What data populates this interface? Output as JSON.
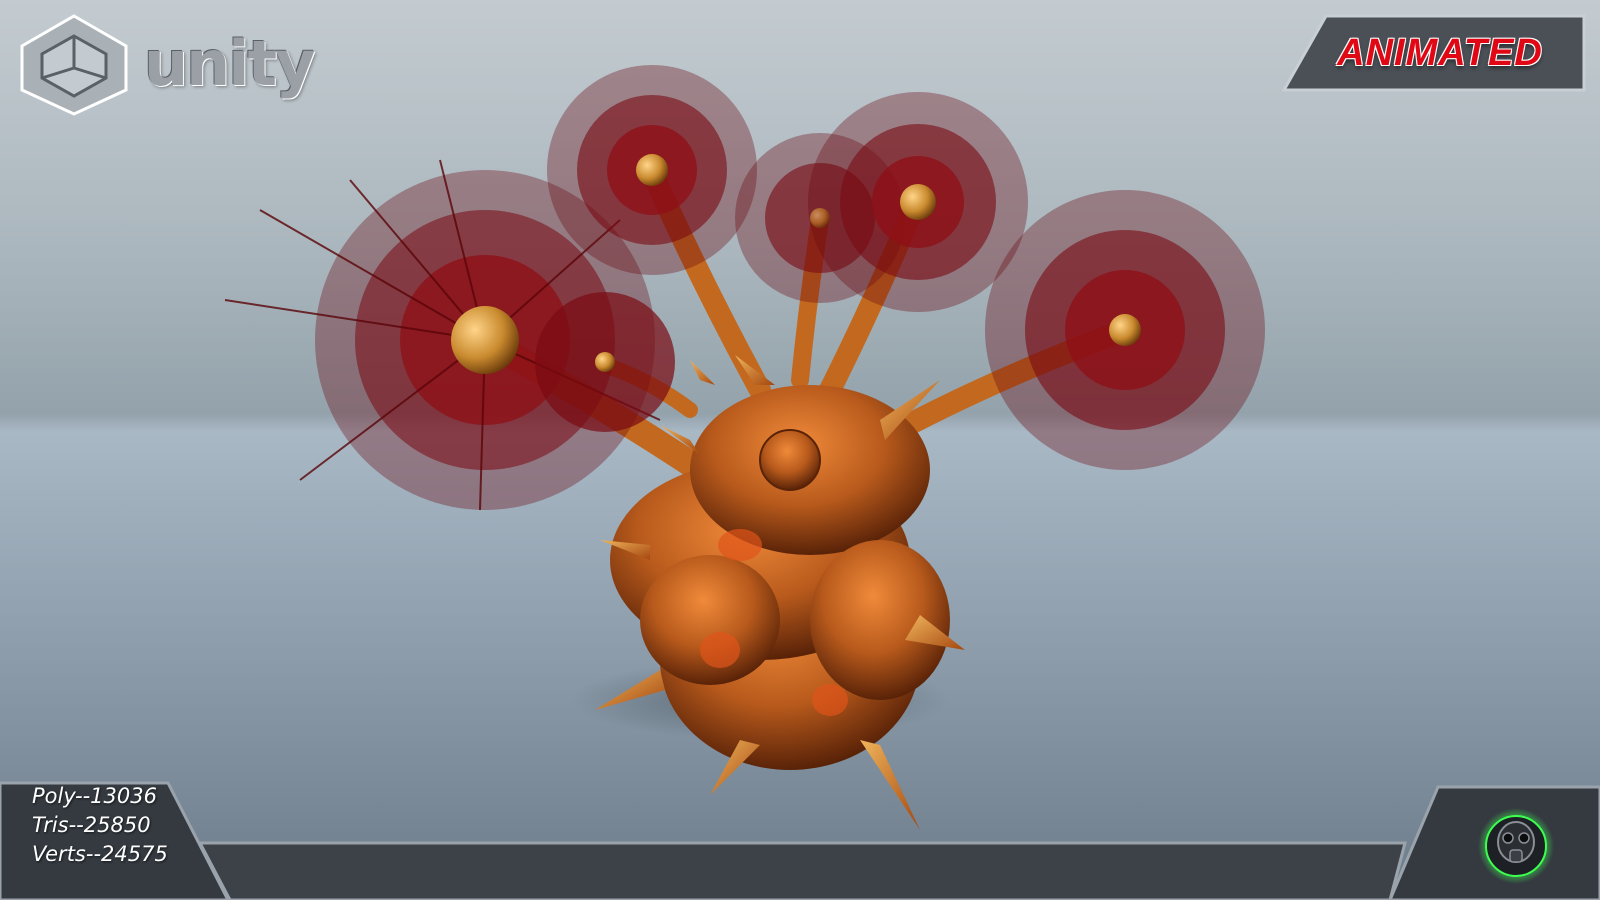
{
  "header": {
    "logo_text": "unity",
    "logo_icon": "unity-cube-icon",
    "badge_label": "ANIMATED"
  },
  "stats": {
    "poly": "Poly--13036",
    "tris": "Tris--25850",
    "verts": "Verts--24575"
  },
  "footer": {
    "emblem_icon": "gas-mask-icon"
  },
  "model": {
    "subject": "spiky orange creature with five red furry flower heads"
  },
  "colors": {
    "badge_text": "#e00814",
    "creature_body": "#b85a1c",
    "fur": "#7a0a12",
    "emblem_glow": "#3cff50",
    "panel": "#3d4248"
  }
}
